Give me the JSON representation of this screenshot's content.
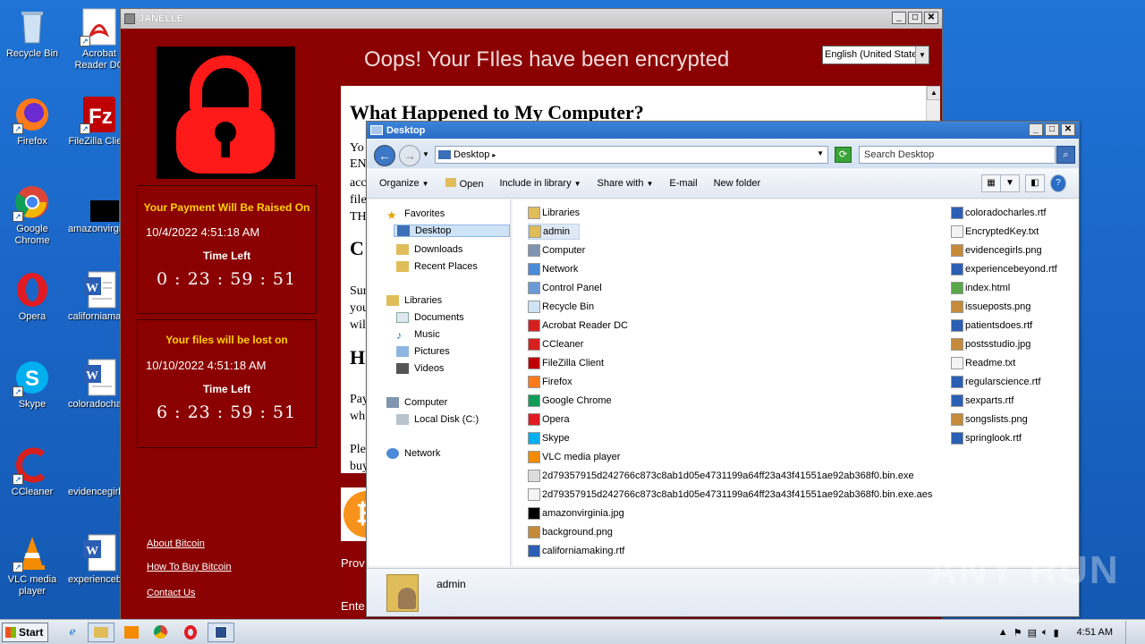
{
  "desktop": {
    "icons": [
      {
        "label": "Recycle Bin"
      },
      {
        "label": "Acrobat Reader DC"
      },
      {
        "label": "Firefox"
      },
      {
        "label": "FileZilla Client"
      },
      {
        "label": "Google Chrome"
      },
      {
        "label": "amazonvirginia.jpg"
      },
      {
        "label": "Opera"
      },
      {
        "label": "californiamaking.rtf"
      },
      {
        "label": "Skype"
      },
      {
        "label": "coloradocharles.rtf"
      },
      {
        "label": "CCleaner"
      },
      {
        "label": "evidencegirls.png"
      },
      {
        "label": "VLC media player"
      },
      {
        "label": "experiencebeyond.rtf"
      }
    ]
  },
  "ransom": {
    "window_title": "JANELLE",
    "heading": "Oops! Your FIles have been encrypted",
    "language": "English (United States)",
    "payment_panel": {
      "title": "Your Payment Will Be Raised On",
      "date": "10/4/2022 4:51:18 AM",
      "time_left_label": "Time Left",
      "timer": "0 : 23 : 59 : 51"
    },
    "lost_panel": {
      "title": "Your files will be lost on",
      "date": "10/10/2022 4:51:18 AM",
      "time_left_label": "Time Left",
      "timer": "6 : 23 : 59 : 51"
    },
    "links": [
      "About Bitcoin",
      "How To Buy Bitcoin",
      "Contact Us"
    ],
    "doc_heading": "What Happened to My Computer?",
    "doc_fragments": [
      "Yo",
      "EN",
      "acc",
      "file",
      "TH",
      "C",
      "Sur",
      "you",
      "wil",
      "H",
      "Pay",
      "wh",
      "Ple",
      "buy"
    ],
    "bottom_texts": [
      "Prov",
      "Ente"
    ]
  },
  "explorer": {
    "window_title": "Desktop",
    "address": "Desktop",
    "search_placeholder": "Search Desktop",
    "toolbar": [
      "Organize",
      "Open",
      "Include in library",
      "Share with",
      "E-mail",
      "New folder"
    ],
    "nav": {
      "favorites": "Favorites",
      "favorites_items": [
        "Desktop",
        "Downloads",
        "Recent Places"
      ],
      "libraries": "Libraries",
      "libraries_items": [
        "Documents",
        "Music",
        "Pictures",
        "Videos"
      ],
      "computer": "Computer",
      "computer_items": [
        "Local Disk (C:)"
      ],
      "network": "Network"
    },
    "files_col1": [
      "Libraries",
      "admin",
      "Computer",
      "Network",
      "Control Panel",
      "Recycle Bin",
      "Acrobat Reader DC",
      "CCleaner",
      "FileZilla Client",
      "Firefox",
      "Google Chrome",
      "Opera",
      "Skype",
      "VLC media player",
      "2d79357915d242766c873c8ab1d05e4731199a64ff23a43f41551ae92ab368f0.bin.exe",
      "2d79357915d242766c873c8ab1d05e4731199a64ff23a43f41551ae92ab368f0.bin.exe.aes",
      "amazonvirginia.jpg",
      "background.png",
      "californiamaking.rtf"
    ],
    "files_col2": [
      "coloradocharles.rtf",
      "EncryptedKey.txt",
      "evidencegirls.png",
      "experiencebeyond.rtf",
      "index.html",
      "issueposts.png",
      "patientsdoes.rtf",
      "postsstudio.jpg",
      "Readme.txt",
      "regularscience.rtf",
      "sexparts.rtf",
      "songslists.png",
      "springlook.rtf"
    ],
    "details_name": "admin"
  },
  "taskbar": {
    "start_label": "Start",
    "clock": "4:51 AM"
  },
  "watermark": "ANY RUN"
}
